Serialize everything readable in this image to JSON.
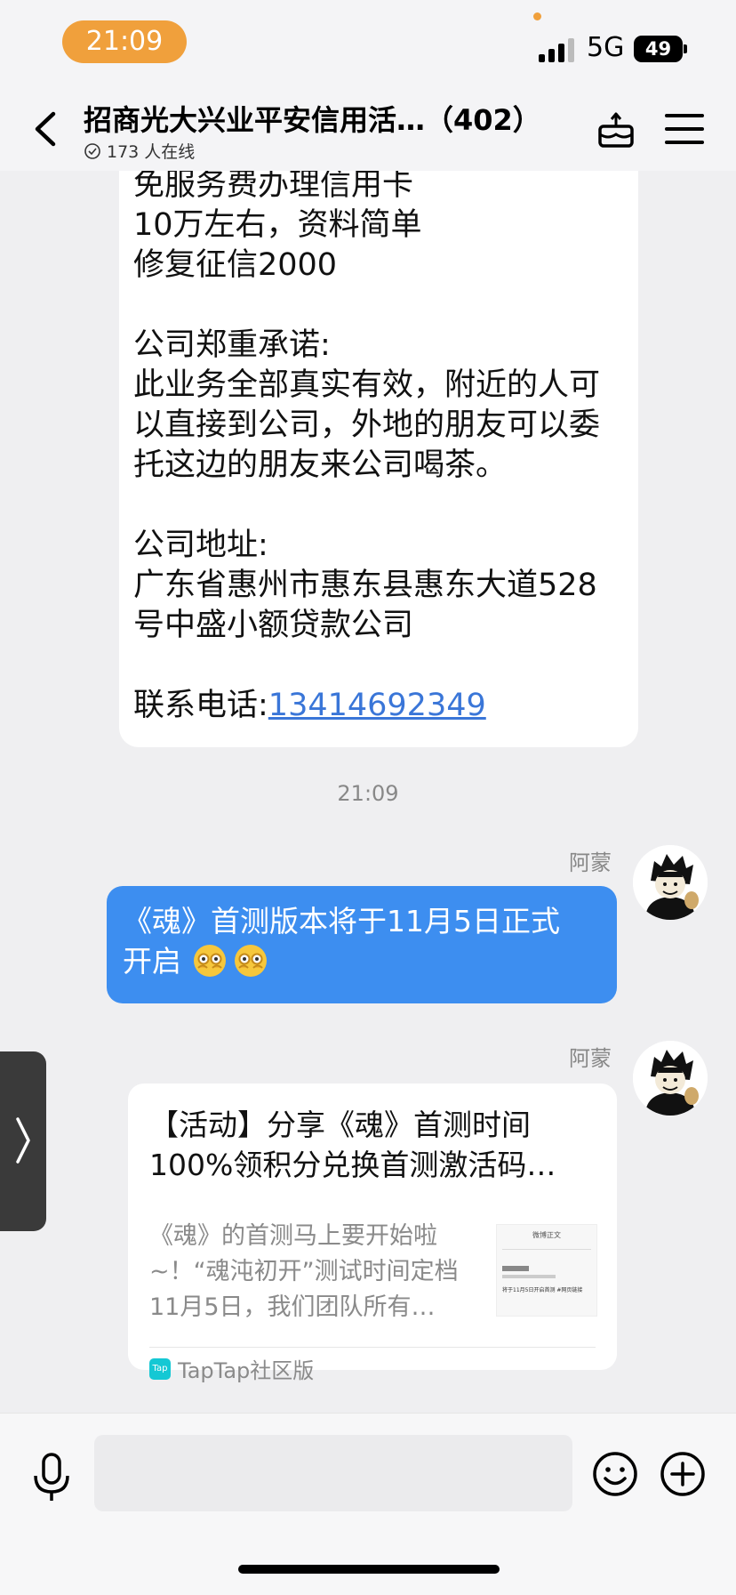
{
  "status_bar": {
    "time": "21:09",
    "network": "5G",
    "battery": "49"
  },
  "header": {
    "title": "招商光大兴业平安信用活…（402）",
    "online": "173 人在线",
    "icons": [
      "back-icon",
      "cake-icon",
      "menu-icon"
    ]
  },
  "messages": {
    "card_lines": [
      "免服务费办理信用卡",
      "10万左右，资料简单",
      "修复征信2000",
      "公司郑重承诺:",
      "此业务全部真实有效，附近的人可",
      "以直接到公司，外地的朋友可以委",
      "托这边的朋友来公司喝茶。",
      "公司地址:",
      "广东省惠州市惠东县惠东大道528",
      "号中盛小额贷款公司"
    ],
    "phone_label": "联系电话:",
    "phone_number": "13414692349",
    "timestamp": "21:09",
    "sender_1": "阿蒙",
    "blue_line_1": "《魂》首测版本将于11月5日正式",
    "blue_line_2": "开启",
    "sender_2": "阿蒙",
    "share": {
      "title": "【活动】分享《魂》首测时间100%领积分兑换首测激活码…",
      "desc": "《魂》的首测马上要开始啦~！“魂沌初开”测试时间定档11月5日，我们团队所有…",
      "source": "TapTap社区版",
      "thumb_heading": "微博正文",
      "thumb_line": "将于11月5日开启首测 #网页链接",
      "logo_text": "Tap"
    }
  },
  "input_bar": {
    "placeholder": "",
    "icons": [
      "mic-icon",
      "emoji-icon",
      "plus-icon"
    ]
  },
  "colors": {
    "accent_orange": "#f0a03c",
    "bubble_blue": "#3d8ef0",
    "link_blue": "#3a76d8"
  }
}
